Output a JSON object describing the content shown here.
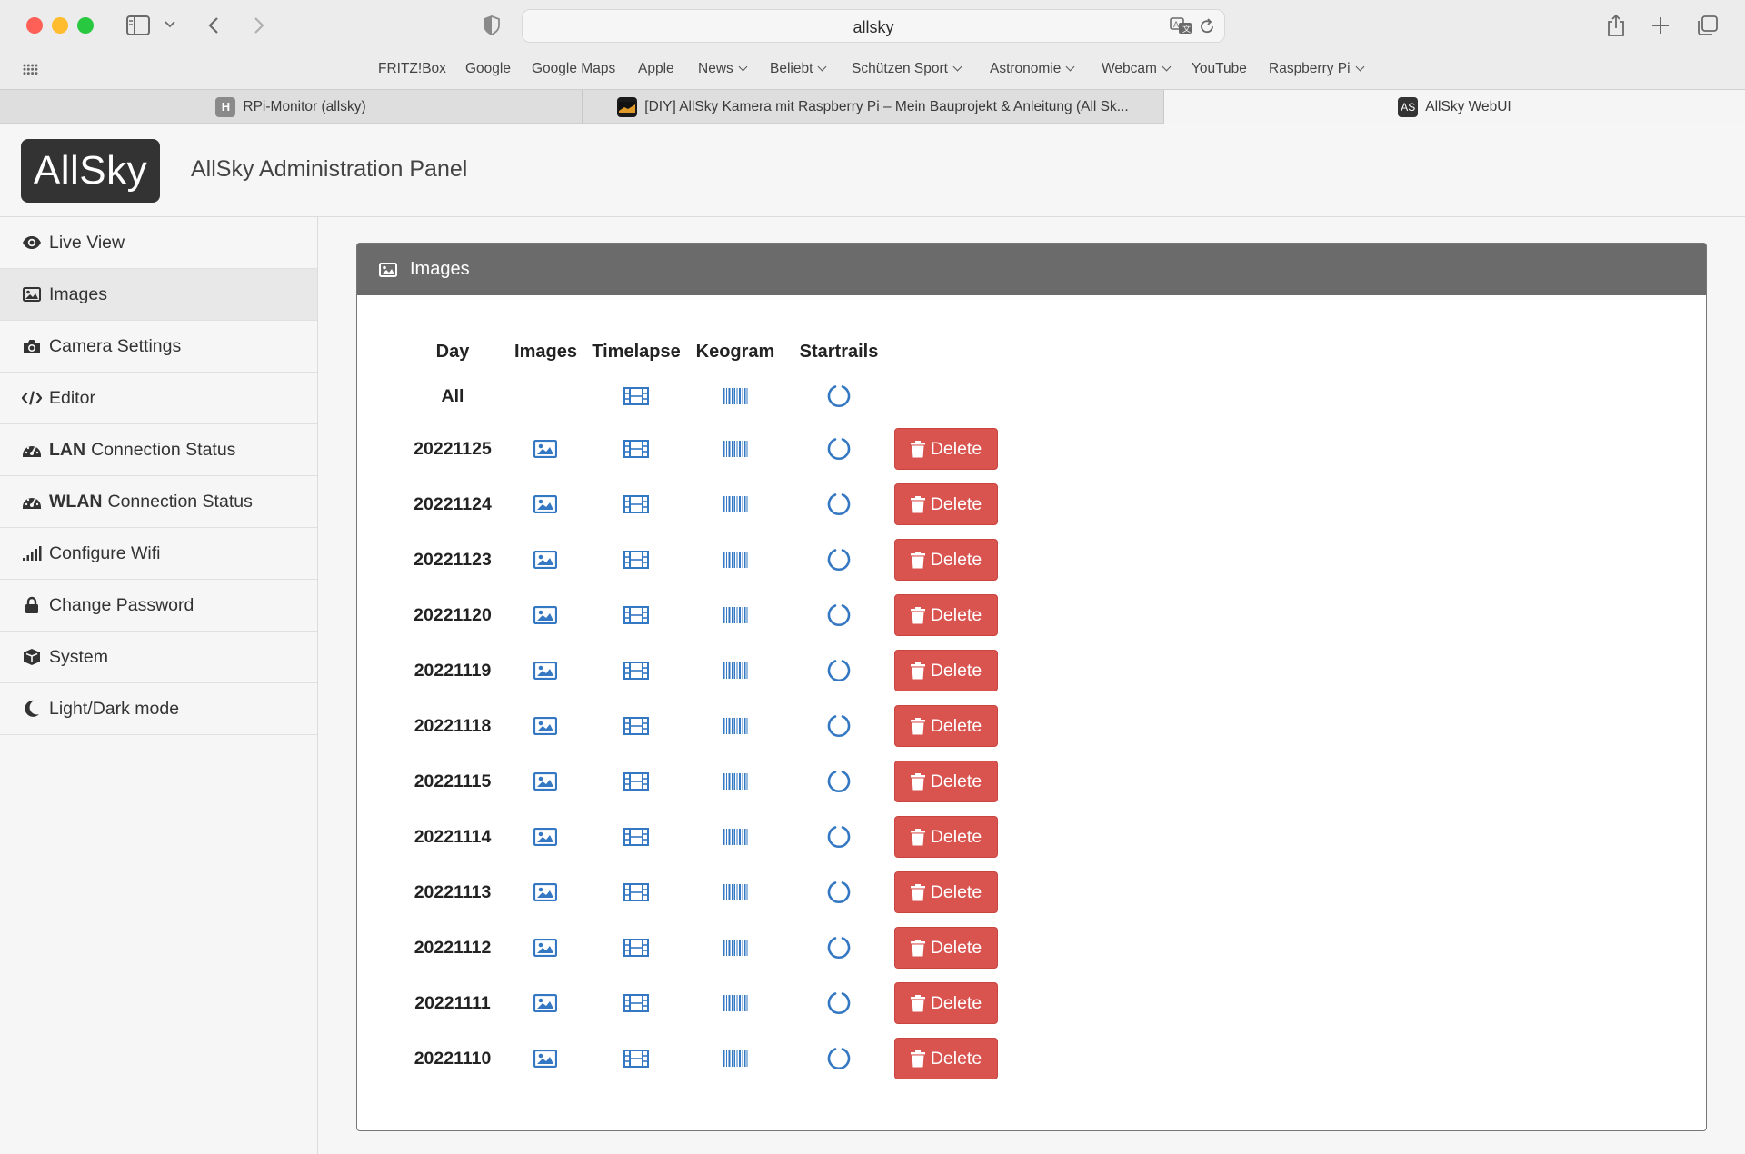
{
  "browser": {
    "address": "allsky",
    "bookmarks": [
      {
        "label": "FRITZ!Box",
        "menu": false
      },
      {
        "label": "Google",
        "menu": false
      },
      {
        "label": "Google Maps",
        "menu": false
      },
      {
        "label": "Apple",
        "menu": false
      },
      {
        "label": "News",
        "menu": true
      },
      {
        "label": "Beliebt",
        "menu": true
      },
      {
        "label": "Schützen Sport",
        "menu": true
      },
      {
        "label": "Astronomie",
        "menu": true
      },
      {
        "label": "Webcam",
        "menu": true
      },
      {
        "label": "YouTube",
        "menu": false
      },
      {
        "label": "Raspberry Pi",
        "menu": true
      }
    ],
    "tabs": [
      {
        "title": "RPi-Monitor (allsky)",
        "favicon": "H"
      },
      {
        "title": "[DIY] AllSky Kamera mit Raspberry Pi – Mein Bauprojekt & Anleitung (All Sk...",
        "favicon": ""
      },
      {
        "title": "AllSky WebUI",
        "favicon": "AS"
      }
    ]
  },
  "app": {
    "logo": "AllSky",
    "title": "AllSky Administration Panel"
  },
  "sidebar": {
    "items": [
      {
        "label": "Live View",
        "bold": "",
        "icon": "eye-icon"
      },
      {
        "label": "Images",
        "bold": "",
        "icon": "image-icon"
      },
      {
        "label": "Camera Settings",
        "bold": "",
        "icon": "camera-icon"
      },
      {
        "label": "Editor",
        "bold": "",
        "icon": "code-icon"
      },
      {
        "label": "Connection Status",
        "bold": "LAN",
        "icon": "tachometer-icon"
      },
      {
        "label": "Connection Status",
        "bold": "WLAN",
        "icon": "tachometer-icon"
      },
      {
        "label": "Configure Wifi",
        "bold": "",
        "icon": "signal-icon"
      },
      {
        "label": "Change Password",
        "bold": "",
        "icon": "lock-icon"
      },
      {
        "label": "System",
        "bold": "",
        "icon": "cube-icon"
      },
      {
        "label": "Light/Dark mode",
        "bold": "",
        "icon": "moon-icon"
      }
    ],
    "active_index": 1
  },
  "panel": {
    "title": "Images",
    "columns": [
      "Day",
      "Images",
      "Timelapse",
      "Keogram",
      "Startrails"
    ],
    "all_label": "All",
    "delete_label": "Delete",
    "days": [
      "20221125",
      "20221124",
      "20221123",
      "20221120",
      "20221119",
      "20221118",
      "20221115",
      "20221114",
      "20221113",
      "20221112",
      "20221111",
      "20221110"
    ]
  },
  "colors": {
    "accent_link": "#3477c2",
    "danger": "#d9534f",
    "panel_header": "#6b6b6b"
  }
}
